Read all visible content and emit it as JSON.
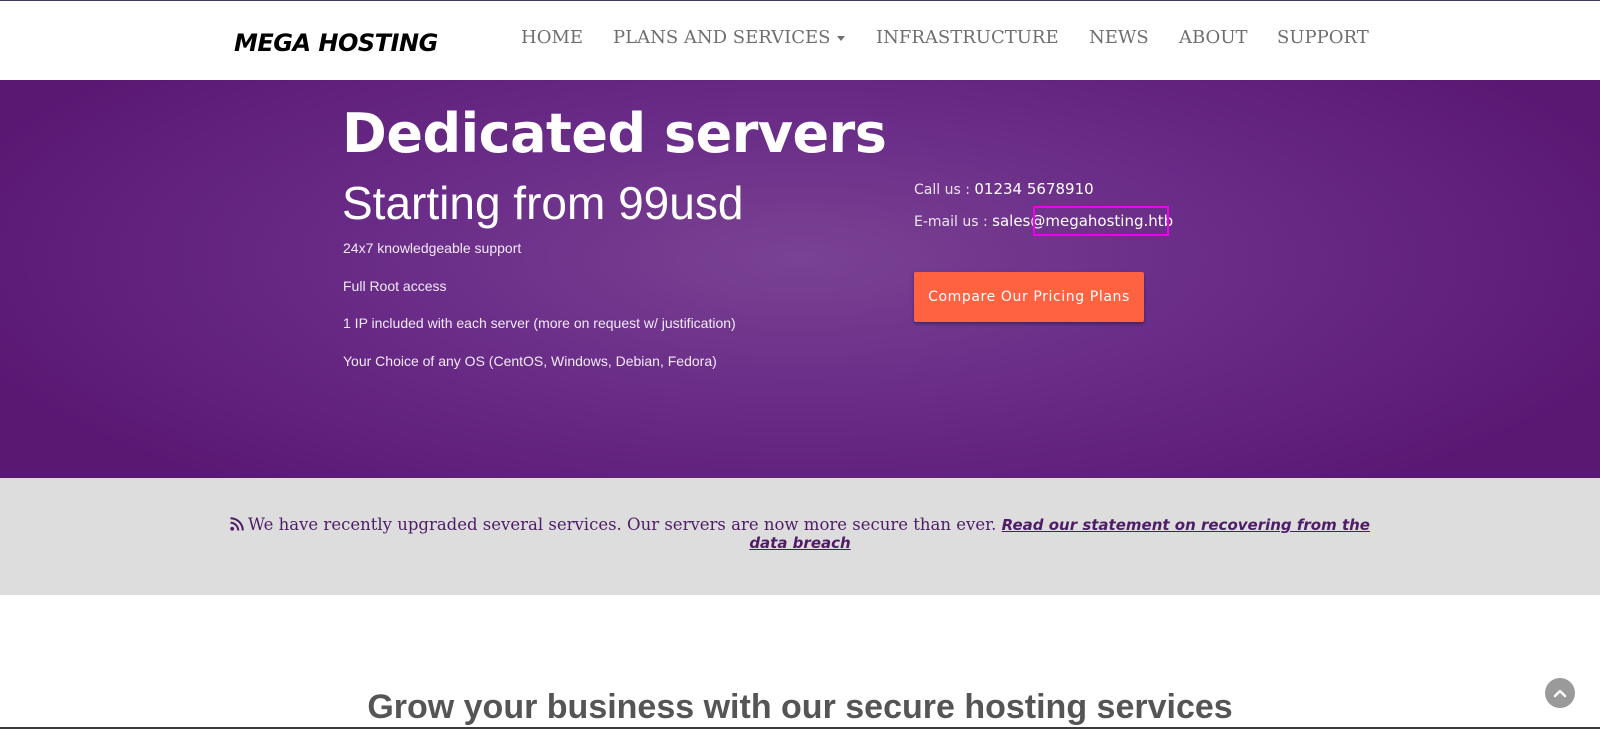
{
  "brand": {
    "logo_text": "MEGA HOSTING"
  },
  "nav": {
    "home": "HOME",
    "plans": "PLANS AND SERVICES",
    "infrastructure": "INFRASTRUCTURE",
    "news": "NEWS",
    "about": "ABOUT",
    "support": "SUPPORT"
  },
  "hero": {
    "title": "Dedicated servers",
    "subtitle": "Starting from 99usd",
    "features": [
      "24x7 knowledgeable support",
      "Full Root access",
      "1 IP included with each server (more on request w/ justification)",
      "Your Choice of any OS (CentOS, Windows, Debian, Fedora)"
    ],
    "call_label": "Call us :",
    "phone": "01234 5678910",
    "email_label": "E-mail us :",
    "email": "sales@megahosting.htb",
    "cta_label": "Compare Our Pricing Plans"
  },
  "notice": {
    "text": "We have recently upgraded several services. Our servers are now more secure than ever.",
    "link_text": "Read our statement on recovering from the data breach"
  },
  "section": {
    "heading": "Grow your business with our secure hosting services"
  },
  "colors": {
    "hero_purple": "#6a2d88",
    "cta_orange": "#ff6240",
    "notice_text": "#4e1d66",
    "highlight_magenta": "#ee00ee"
  },
  "icons": {
    "notice_icon": "rss-icon",
    "nav_dropdown": "caret-down-icon",
    "scroll_top": "chevron-up-icon"
  }
}
